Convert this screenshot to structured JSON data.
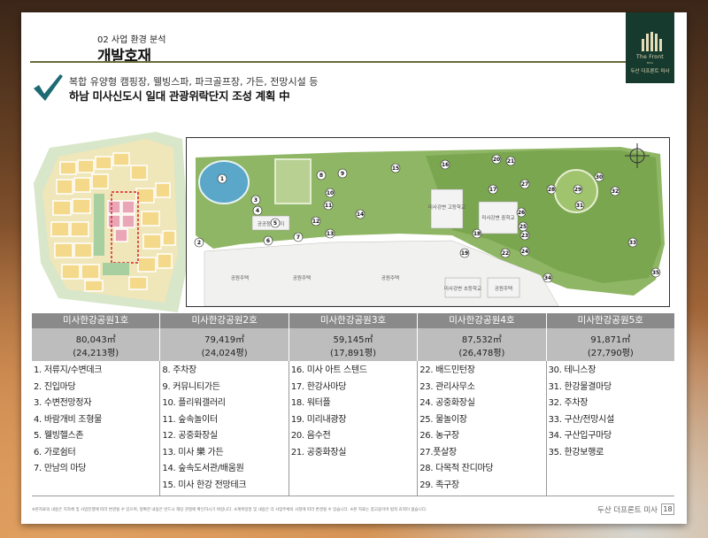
{
  "header": {
    "section": "02   사업 환경 분석",
    "title": "개발호재"
  },
  "logo": {
    "name": "The Front",
    "small": "MISA",
    "korean": "두산 더프론트 미사"
  },
  "headline": {
    "line1": "복합 유양형 캠핑장, 웰빙스파, 파크골프장, 가든, 전망시설 등",
    "line2": "하남 미사신도시 일대 관광위락단지 조성 계획 中"
  },
  "map": {
    "labels": [
      "공공청사부지",
      "공원주택",
      "공원주택",
      "공원주택",
      "미사강변 고등학교",
      "미사강변 중학교",
      "미사강변 초등학교",
      "공원주택"
    ],
    "numbers": [
      "1",
      "2",
      "3",
      "4",
      "5",
      "6",
      "7",
      "8",
      "9",
      "10",
      "11",
      "12",
      "13",
      "14",
      "15",
      "16",
      "17",
      "18",
      "19",
      "20",
      "21",
      "22",
      "23",
      "24",
      "25",
      "26",
      "27",
      "28",
      "29",
      "30",
      "31",
      "32",
      "33",
      "34",
      "35"
    ]
  },
  "parks": [
    {
      "name": "미사한강공원1호",
      "area": "80,043㎡",
      "pyeong": "(24,213평)",
      "items": [
        "1. 저류지/수변데크",
        "2. 진입마당",
        "3. 수변전망정자",
        "4. 바람개비 조형물",
        "5. 웰빙헬스존",
        "6. 가로쉼터",
        "7. 만남의 마당"
      ]
    },
    {
      "name": "미사한강공원2호",
      "area": "79,419㎡",
      "pyeong": "(24,024평)",
      "items": [
        "8. 주차장",
        "9. 커뮤니티가든",
        "10. 플리워갤러리",
        "11. 숲속놀이터",
        "12. 공중화장실",
        "13. 미사 樂 가든",
        "14. 숲속도서관/배움원",
        "15. 미사 한강 전망테크"
      ]
    },
    {
      "name": "미사한강공원3호",
      "area": "59,145㎡",
      "pyeong": "(17,891평)",
      "items": [
        "16. 미사 아트 스텐드",
        "17. 한강사마당",
        "18. 워터플",
        "19. 미리내광장",
        "20. 음수전",
        "21. 공중화장실"
      ]
    },
    {
      "name": "미사한강공원4호",
      "area": "87,532㎡",
      "pyeong": "(26,478평)",
      "items": [
        "22. 배드민턴장",
        "23. 관리사무소",
        "24. 공중화장실",
        "25. 물놀이장",
        "26. 농구장",
        "27.풋살장",
        "28. 다목적 잔디마당",
        "29. 족구장"
      ]
    },
    {
      "name": "미사한강공원5호",
      "area": "91,871㎡",
      "pyeong": "(27,790평)",
      "items": [
        "30. 테니스장",
        "31. 한강물결마당",
        "32. 주차장",
        "33. 구산/전망시설",
        "34. 구산입구마당",
        "35. 한강보행로"
      ]
    }
  ],
  "footer": {
    "note": "※본자료의 내용은 지자체 및 사업진행에 따라 변경될 수 있으며, 정확한 내용은 반드시 해당 관청에 확인하시기 바랍니다. ※계획일정 및 내용은 각 사업주체의 사정에 따라 변경될 수 있습니다. ※본 자료는 참고용이며 법적 효력이 없습니다.",
    "brand": "두산 더프론트 미사",
    "page": "18"
  }
}
